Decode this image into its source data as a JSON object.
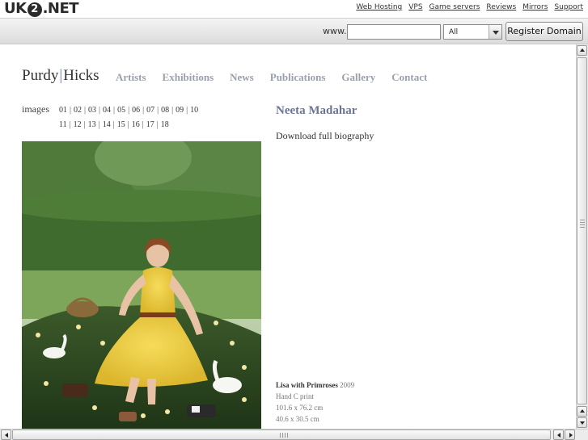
{
  "host": {
    "logo_prefix": "UK",
    "logo_circle": "2",
    "logo_suffix": ".NET",
    "links": [
      "Web Hosting",
      "VPS",
      "Game servers",
      "Reviews",
      "Mirrors",
      "Support"
    ]
  },
  "search": {
    "www_label": "www.",
    "domain_value": "",
    "tld_selected": "All",
    "register_label": "Register Domain"
  },
  "site": {
    "logo_left": "Purdy",
    "logo_sep": "|",
    "logo_right": "Hicks",
    "nav": [
      "Artists",
      "Exhibitions",
      "News",
      "Publications",
      "Gallery",
      "Contact"
    ]
  },
  "images": {
    "label": "images",
    "row1": [
      "01",
      "02",
      "03",
      "04",
      "05",
      "06",
      "07",
      "08",
      "09",
      "10"
    ],
    "row2": [
      "11",
      "12",
      "13",
      "14",
      "15",
      "16",
      "17",
      "18"
    ]
  },
  "artist": {
    "name": "Neeta Madahar",
    "bio_link": "Download full biography"
  },
  "caption": {
    "title": "Lisa with Primroses",
    "year": "2009",
    "medium": "Hand C print",
    "size_cm_1": "101.6 x 76.2 cm",
    "size_cm_2": "40.6 x 30.5 cm"
  },
  "colors": {
    "nav_text": "#9aa0ad",
    "artist_name": "#6b7593",
    "logo_bar": "#6b7fb0"
  }
}
